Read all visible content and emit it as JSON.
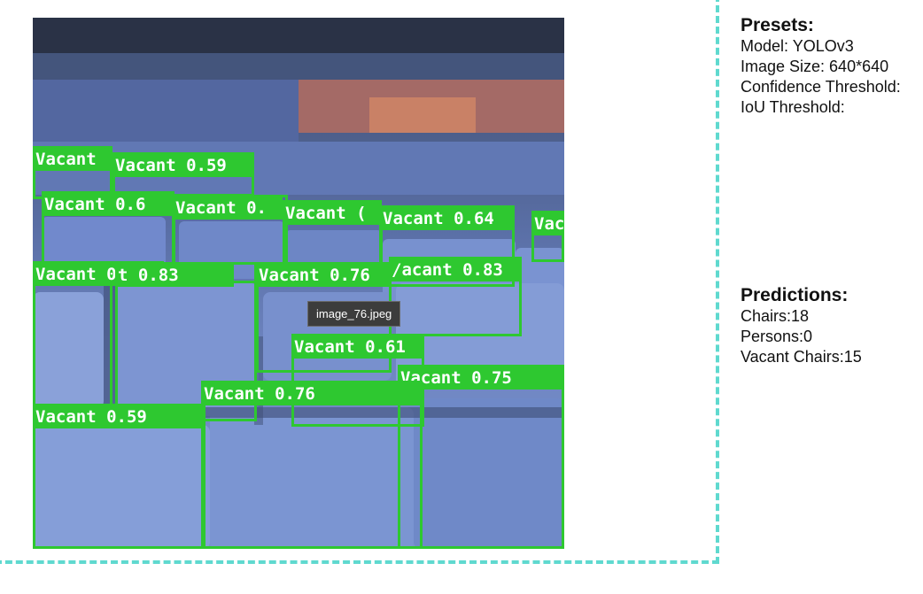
{
  "image": {
    "tooltip": "image_76.jpeg",
    "box_color": "#2ec830",
    "detections": [
      {
        "label": "Vacant"
      },
      {
        "label": "Vacant 0.59"
      },
      {
        "label": "Vacant 0.6"
      },
      {
        "label": "Vacant 0."
      },
      {
        "label": "Vacant ("
      },
      {
        "label": "Vacant 0.64"
      },
      {
        "label": "Vac"
      },
      {
        "label": "Vacant 0.50"
      },
      {
        "label": "t 0.83"
      },
      {
        "label": "Vacant 0.76"
      },
      {
        "label": "/acant 0.83"
      },
      {
        "label": "Vacant 0.61"
      },
      {
        "label": "Vacant 0.75"
      },
      {
        "label": "Vacant 0.76"
      },
      {
        "label": "Vacant 0.59"
      }
    ]
  },
  "presets": {
    "title": "Presets:",
    "model": "Model: YOLOv3",
    "image_size": "Image Size: 640*640",
    "confidence": "Confidence Threshold:",
    "iou": "IoU Threshold:"
  },
  "predictions": {
    "title": "Predictions:",
    "chairs": "Chairs:18",
    "persons": "Persons:0",
    "vacant": "Vacant Chairs:15"
  }
}
